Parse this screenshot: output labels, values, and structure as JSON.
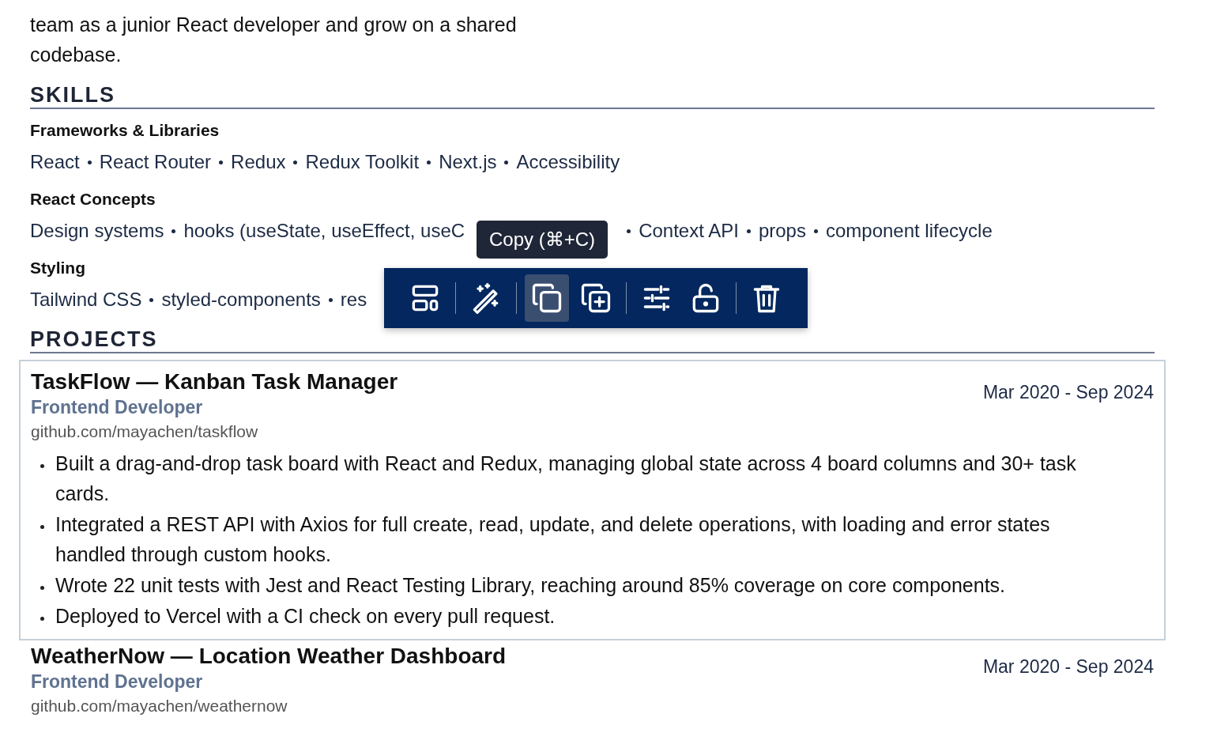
{
  "summary": {
    "lines": [
      "team as a junior React developer and grow on a shared",
      "codebase."
    ]
  },
  "skills": {
    "heading": "SKILLS",
    "groups": [
      {
        "title": "Frameworks & Libraries",
        "items": [
          "React",
          "React Router",
          "Redux",
          "Redux Toolkit",
          "Next.js",
          "Accessibility"
        ]
      },
      {
        "title": "React Concepts",
        "items": [
          "Design systems",
          "hooks (useState, useEffect, useC"
        ],
        "items_after_overlay": [
          "Context API",
          "props",
          "component lifecycle"
        ]
      },
      {
        "title": "Styling",
        "items": [
          "Tailwind CSS",
          "styled-components",
          "res"
        ]
      }
    ]
  },
  "tooltip": {
    "text": "Copy (⌘+C)"
  },
  "toolbar": {
    "groups": [
      [
        {
          "kind": "layout",
          "selected": false
        }
      ],
      [
        {
          "kind": "magic",
          "selected": false
        }
      ],
      [
        {
          "kind": "copy",
          "selected": true
        },
        {
          "kind": "duplicate",
          "selected": false
        }
      ],
      [
        {
          "kind": "adjust",
          "selected": false
        },
        {
          "kind": "unlock",
          "selected": false
        }
      ],
      [
        {
          "kind": "delete",
          "selected": false
        }
      ]
    ]
  },
  "projects": {
    "heading": "PROJECTS",
    "items": [
      {
        "title": "TaskFlow — Kanban Task Manager",
        "role": "Frontend Developer",
        "link": "github.com/mayachen/taskflow",
        "dates": "Mar 2020 - Sep 2024",
        "selected": true,
        "bullets": [
          "Built a drag-and-drop task board with React and Redux, managing global state across 4 board columns and 30+ task cards.",
          "Integrated a REST API with Axios for full create, read, update, and delete operations, with loading and error states handled through custom hooks.",
          "Wrote 22 unit tests with Jest and React Testing Library, reaching around 85% coverage on core components.",
          "Deployed to Vercel with a CI check on every pull request."
        ]
      },
      {
        "title": "WeatherNow — Location Weather Dashboard",
        "role": "Frontend Developer",
        "link": "github.com/mayachen/weathernow",
        "dates": "Mar 2020 - Sep 2024",
        "selected": false
      }
    ]
  }
}
